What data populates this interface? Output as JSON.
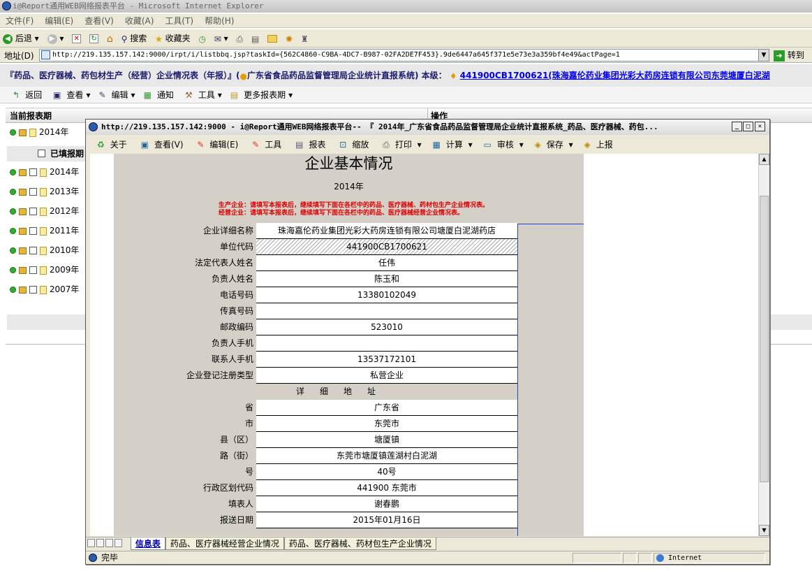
{
  "browser": {
    "title": "i@Report通用WEB网络报表平台 - Microsoft Internet Explorer",
    "menu": [
      "文件(F)",
      "编辑(E)",
      "查看(V)",
      "收藏(A)",
      "工具(T)",
      "帮助(H)"
    ],
    "toolbar": {
      "back": "后退",
      "search": "搜索",
      "favorites": "收藏夹"
    },
    "address_label": "地址(D)",
    "address_url": "http://219.135.157.142:9000/irpt/i/listbbq.jsp?taskId={562C4860-C9BA-4DC7-B987-02FA2DE7F453}.9de6447a645f371e5e73e3a359bf4e49&actPage=1",
    "go_label": "转到"
  },
  "banner": {
    "text": "『药品、医疗器械、药包材生产（经营）企业情况表（年报）』(",
    "system": "广东省食品药品监督管理局企业统计直报系统) 本级：",
    "link": "441900CB1700621(珠海嘉伦药业集团光彩大药房连锁有限公司东莞塘厦白泥湖"
  },
  "app_toolbar": [
    "返回",
    "查看",
    "编辑",
    "通知",
    "工具",
    "更多报表期"
  ],
  "list": {
    "col_period": "当前报表期",
    "col_action": "操作",
    "current": "2014年",
    "filled_header": "已填报期",
    "years": [
      "2014年",
      "2013年",
      "2012年",
      "2011年",
      "2010年",
      "2009年",
      "2007年"
    ]
  },
  "popup": {
    "title": "http://219.135.157.142:9000 - i@Report通用WEB网络报表平台-- 『 2014年_广东省食品药品监督管理局企业统计直报系统_药品、医疗器械、药包...",
    "toolbar": [
      "关于",
      "查看(V)",
      "编辑(E)",
      "工具",
      "报表",
      "缩放",
      "打印",
      "计算",
      "审核",
      "保存",
      "上报"
    ],
    "form_title": "企业基本情况",
    "form_year": "2014年",
    "note1": "生产企业：请填写本报表后，继续填写下面在各栏中的药品、医疗器械、药材包生产企业情况表。",
    "note2": "经营企业：请填写本报表后，继续填写下面在各栏中的药品、医疗器械经营企业情况表。",
    "fields": [
      {
        "label": "企业详细名称",
        "value": "珠海嘉伦药业集团光彩大药房连锁有限公司塘厦白泥湖药店"
      },
      {
        "label": "单位代码",
        "value": "441900CB1700621"
      },
      {
        "label": "法定代表人姓名",
        "value": "任伟"
      },
      {
        "label": "负责人姓名",
        "value": "陈玉和"
      },
      {
        "label": "电话号码",
        "value": "13380102049"
      },
      {
        "label": "传真号码",
        "value": ""
      },
      {
        "label": "邮政编码",
        "value": "523010"
      },
      {
        "label": "负责人手机",
        "value": ""
      },
      {
        "label": "联系人手机",
        "value": "13537172101"
      },
      {
        "label": "企业登记注册类型",
        "value": "私营企业"
      }
    ],
    "section": "详细地址",
    "address_fields": [
      {
        "label": "省",
        "value": "广东省"
      },
      {
        "label": "市",
        "value": "东莞市"
      },
      {
        "label": "县（区）",
        "value": "塘厦镇"
      },
      {
        "label": "路（街）",
        "value": "东莞市塘厦镇莲湖村白泥湖"
      },
      {
        "label": "号",
        "value": "40号"
      },
      {
        "label": "行政区划代码",
        "value": "441900  东莞市"
      },
      {
        "label": "填表人",
        "value": "谢春鹏"
      },
      {
        "label": "报送日期",
        "value": "2015年01月16日"
      }
    ],
    "tabs": [
      "信息表",
      "药品、医疗器械经营企业情况",
      "药品、医疗器械、药材包生产企业情况"
    ],
    "status": "完毕",
    "zone": "Internet"
  }
}
